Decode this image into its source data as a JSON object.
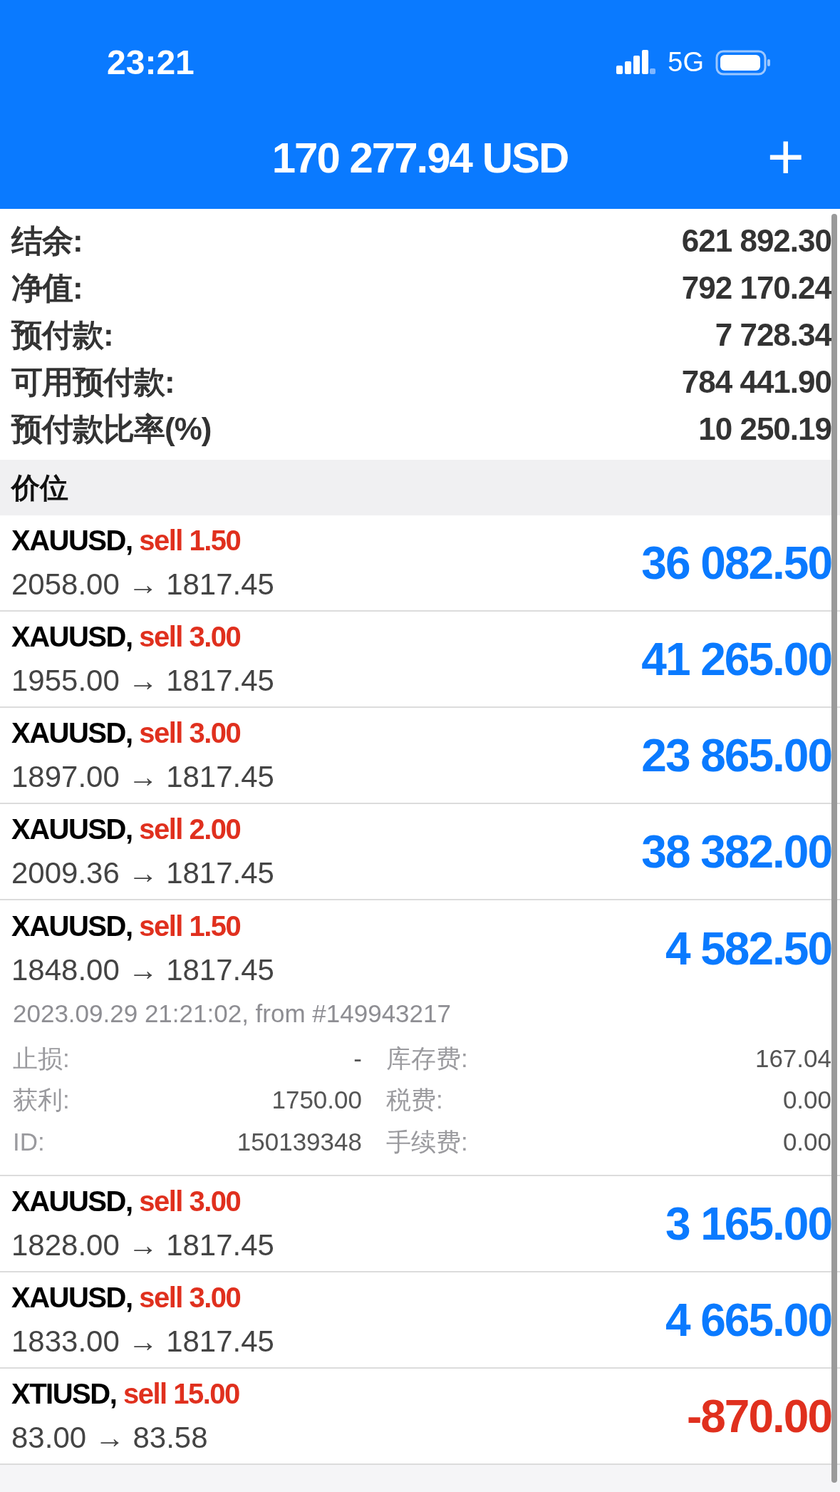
{
  "status_bar": {
    "time": "23:21",
    "network": "5G"
  },
  "header": {
    "title": "170 277.94 USD",
    "action": "+"
  },
  "account": [
    {
      "label": "结余:",
      "value": "621 892.30"
    },
    {
      "label": "净值:",
      "value": "792 170.24"
    },
    {
      "label": "预付款:",
      "value": "7 728.34"
    },
    {
      "label": "可用预付款:",
      "value": "784 441.90"
    },
    {
      "label": "预付款比率(%)",
      "value": "10 250.19"
    }
  ],
  "section_title": "价位",
  "positions": [
    {
      "symbol": "XAUUSD,",
      "order": "sell 1.50",
      "prices": "2058.00 → 1817.45",
      "profit": "36 082.50",
      "loss": false
    },
    {
      "symbol": "XAUUSD,",
      "order": "sell 3.00",
      "prices": "1955.00 → 1817.45",
      "profit": "41 265.00",
      "loss": false
    },
    {
      "symbol": "XAUUSD,",
      "order": "sell 3.00",
      "prices": "1897.00 → 1817.45",
      "profit": "23 865.00",
      "loss": false
    },
    {
      "symbol": "XAUUSD,",
      "order": "sell 2.00",
      "prices": "2009.36 → 1817.45",
      "profit": "38 382.00",
      "loss": false
    },
    {
      "symbol": "XAUUSD,",
      "order": "sell 1.50",
      "prices": "1848.00 → 1817.45",
      "profit": "4 582.50",
      "loss": false,
      "details": {
        "opened": "2023.09.29 21:21:02, from #149943217",
        "fields": [
          {
            "label": "止损:",
            "value": "-"
          },
          {
            "label": "库存费:",
            "value": "167.04"
          },
          {
            "label": "获利:",
            "value": "1750.00"
          },
          {
            "label": "税费:",
            "value": "0.00"
          },
          {
            "label": "ID:",
            "value": "150139348"
          },
          {
            "label": "手续费:",
            "value": "0.00"
          }
        ]
      }
    },
    {
      "symbol": "XAUUSD,",
      "order": "sell 3.00",
      "prices": "1828.00 → 1817.45",
      "profit": "3 165.00",
      "loss": false
    },
    {
      "symbol": "XAUUSD,",
      "order": "sell 3.00",
      "prices": "1833.00 → 1817.45",
      "profit": "4 665.00",
      "loss": false
    },
    {
      "symbol": "XTIUSD,",
      "order": "sell 15.00",
      "prices": "83.00 → 83.58",
      "profit": "-870.00",
      "loss": true
    }
  ]
}
